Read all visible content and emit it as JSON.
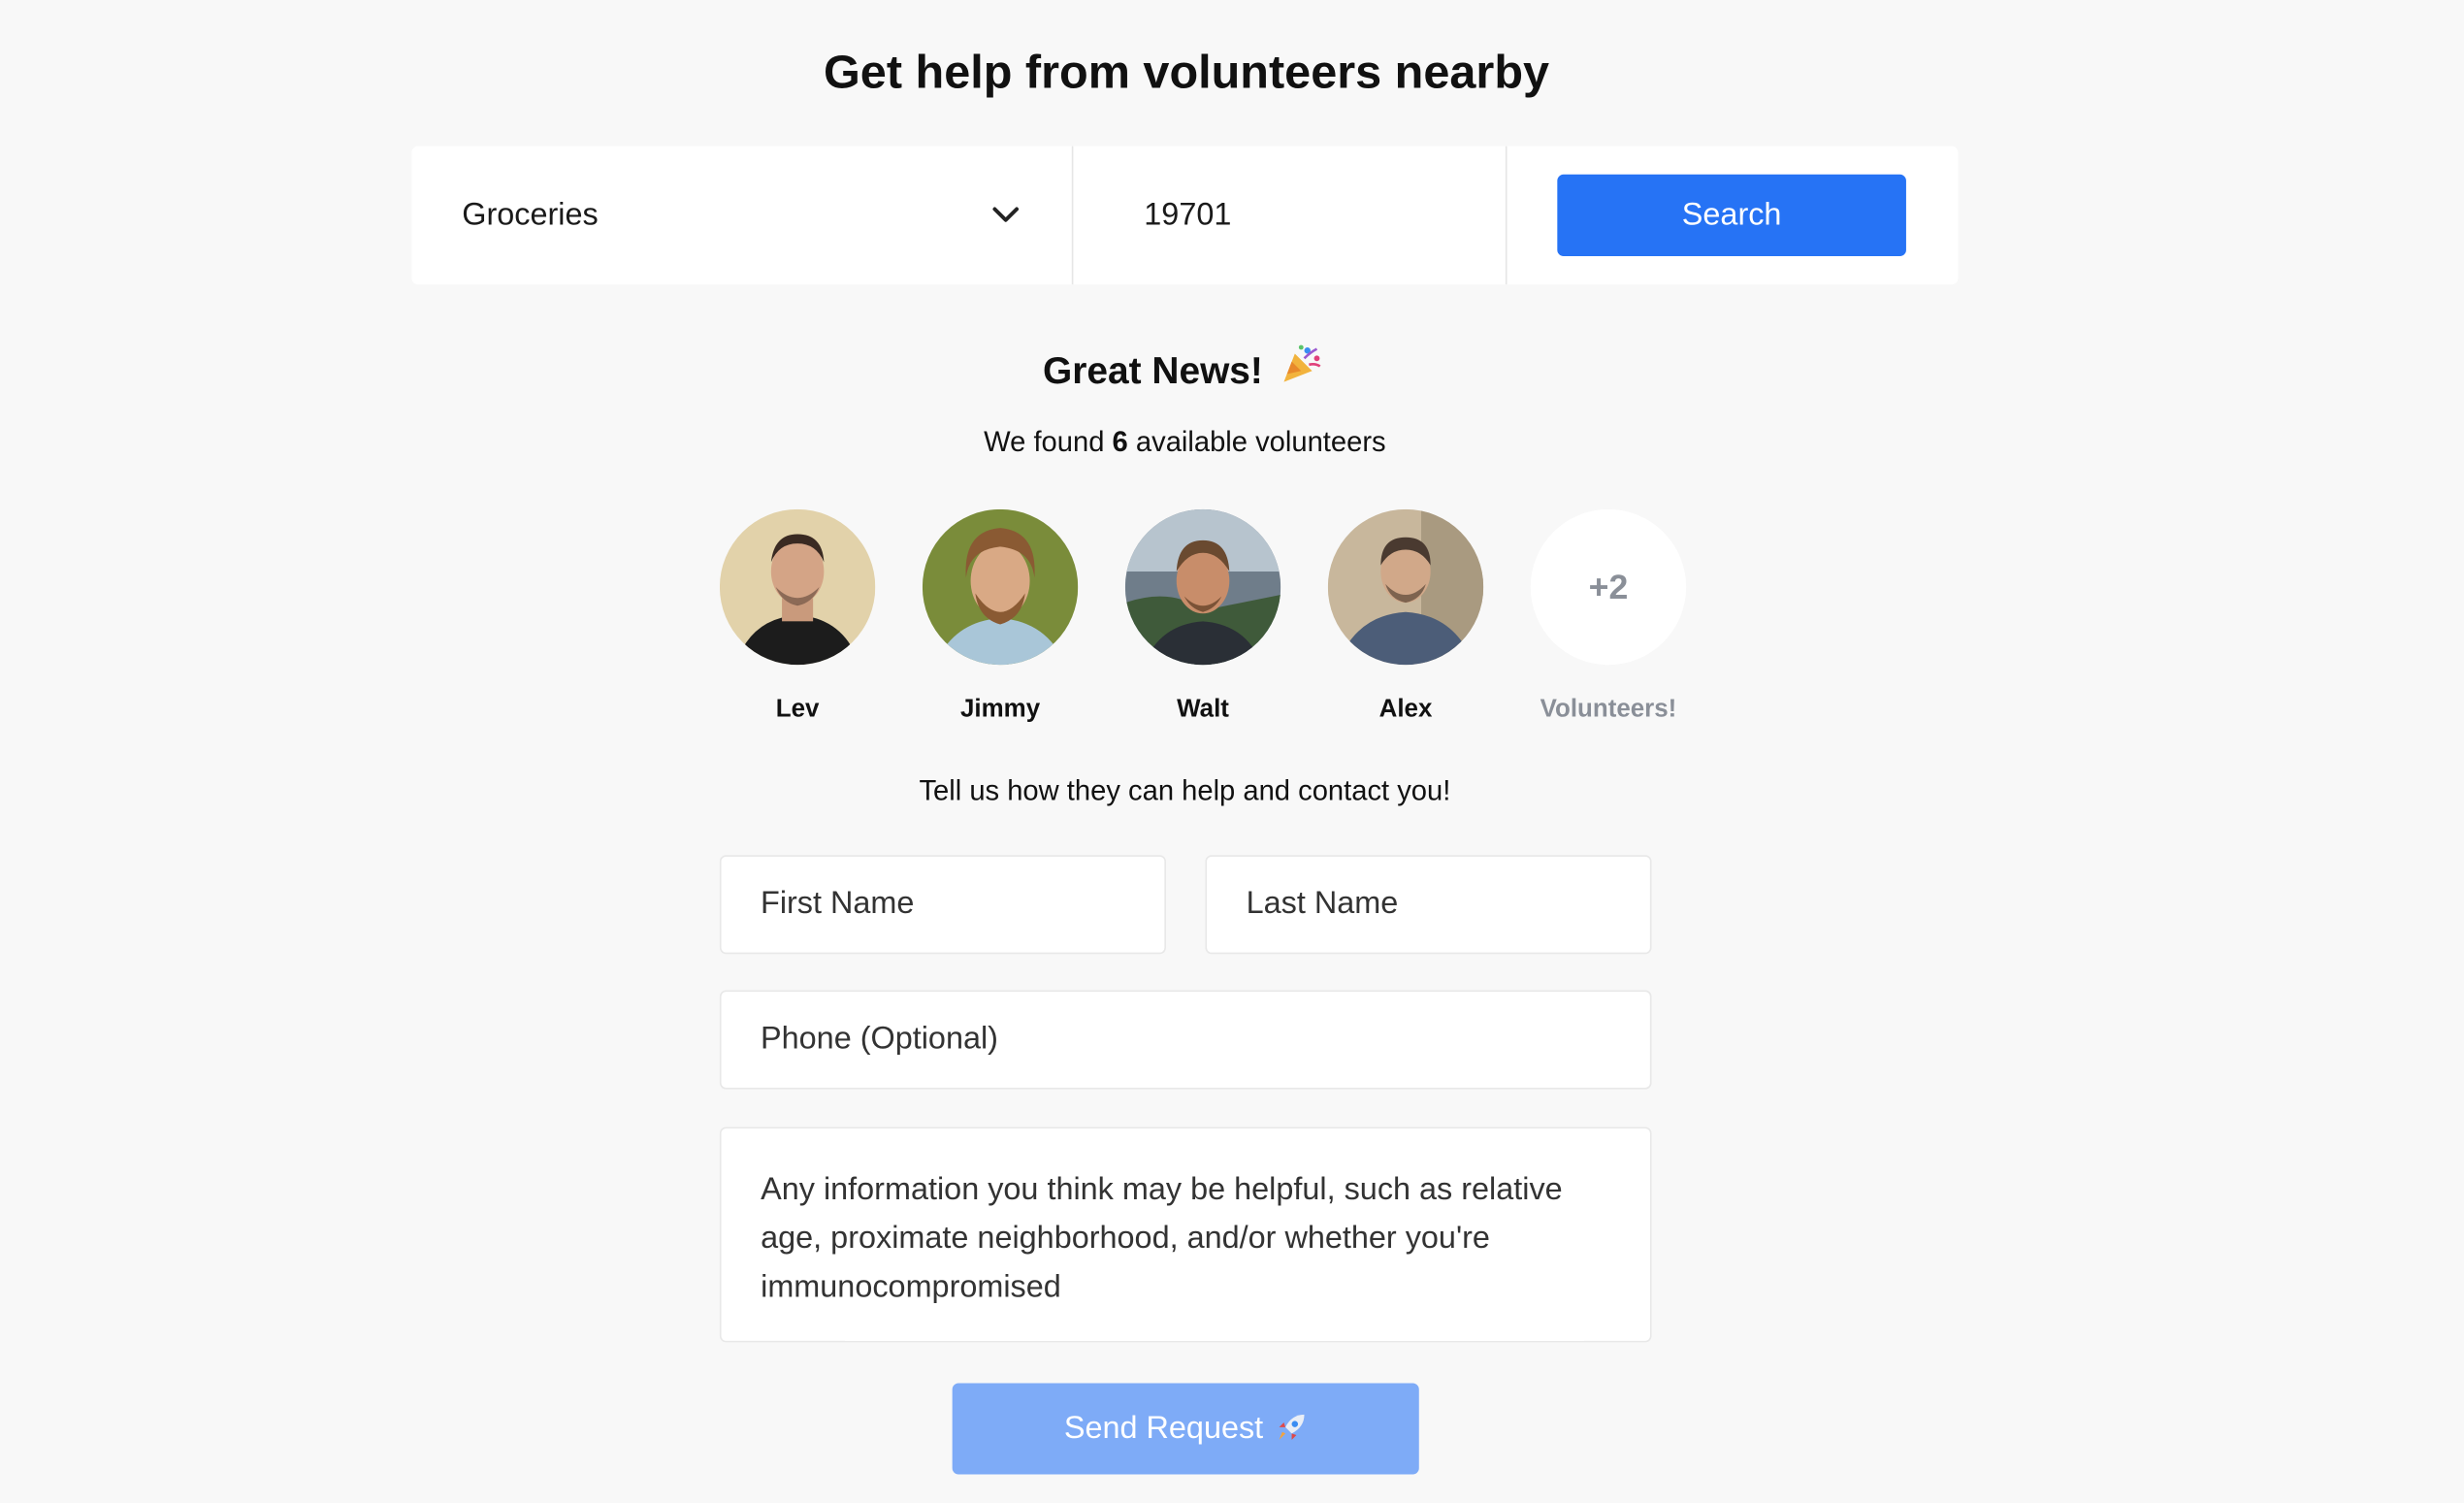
{
  "header": {
    "title": "Get help from volunteers nearby"
  },
  "search": {
    "category": "Groceries",
    "zip_value": "19701",
    "button_label": "Search",
    "icon": "chevron-down-icon"
  },
  "results": {
    "heading": "Great News!",
    "heading_icon": "party-popper-icon",
    "found_prefix": "We found",
    "found_count": "6",
    "found_suffix": "available volunteers",
    "volunteers": [
      {
        "name": "Lev"
      },
      {
        "name": "Jimmy"
      },
      {
        "name": "Walt"
      },
      {
        "name": "Alex"
      }
    ],
    "more_count": "+2",
    "more_label": "Volunteers!"
  },
  "form": {
    "prompt": "Tell us how they can help and contact you!",
    "first_name_placeholder": "First Name",
    "last_name_placeholder": "Last Name",
    "phone_placeholder": "Phone (Optional)",
    "info_placeholder": "Any information you think may be helpful, such as relative age, proximate neighborhood, and/or whether you're immunocompromised",
    "submit_label": "Send Request",
    "submit_icon": "rocket-icon"
  },
  "colors": {
    "background": "#f8f8f8",
    "primary": "#2673f5",
    "primary_disabled": "#7eabf7",
    "muted": "#8a8f98"
  }
}
